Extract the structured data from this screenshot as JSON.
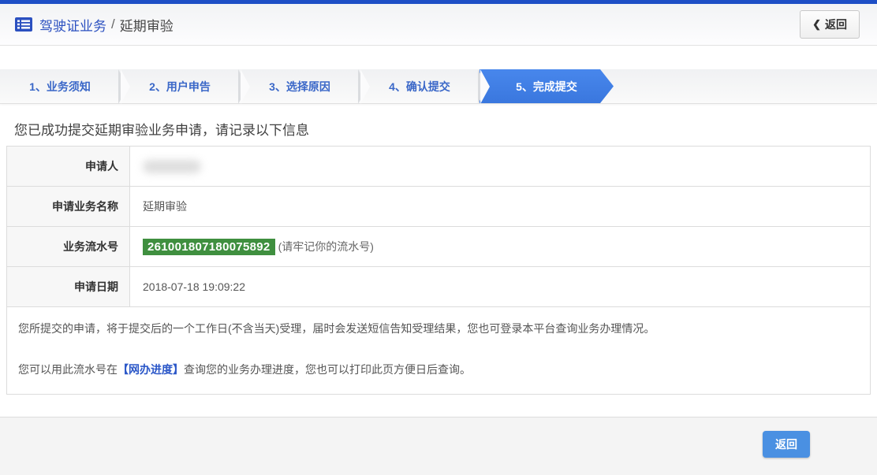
{
  "header": {
    "title_primary": "驾驶证业务",
    "title_separator": "/",
    "title_secondary": "延期审验",
    "back_chevron": "❮",
    "back_label": "返回"
  },
  "steps": [
    {
      "label": "1、业务须知",
      "active": false
    },
    {
      "label": "2、用户申告",
      "active": false
    },
    {
      "label": "3、选择原因",
      "active": false
    },
    {
      "label": "4、确认提交",
      "active": false
    },
    {
      "label": "5、完成提交",
      "active": true
    }
  ],
  "message": "您已成功提交延期审验业务申请，请记录以下信息",
  "table": {
    "rows": [
      {
        "label": "申请人",
        "value": "",
        "redacted": true
      },
      {
        "label": "申请业务名称",
        "value": "延期审验"
      },
      {
        "label": "业务流水号",
        "serial": "261001807180075892",
        "note": "(请牢记你的流水号)"
      },
      {
        "label": "申请日期",
        "value": "2018-07-18 19:09:22"
      }
    ]
  },
  "notes": {
    "p1": "您所提交的申请，将于提交后的一个工作日(不含当天)受理，届时会发送短信告知受理结果，您也可登录本平台查询业务办理情况。",
    "p2_prefix": "您可以用此流水号在",
    "p2_link": "【网办进度】",
    "p2_suffix": "查询您的业务办理进度，您也可以打印此页方便日后查询。"
  },
  "footer": {
    "back_label": "返回"
  },
  "colors": {
    "accent_blue": "#1d4ec6",
    "step_active_blue": "#3e7ee4",
    "serial_green": "#3f8f3f",
    "button_blue": "#4a90e2",
    "link_blue": "#2b57c8"
  }
}
